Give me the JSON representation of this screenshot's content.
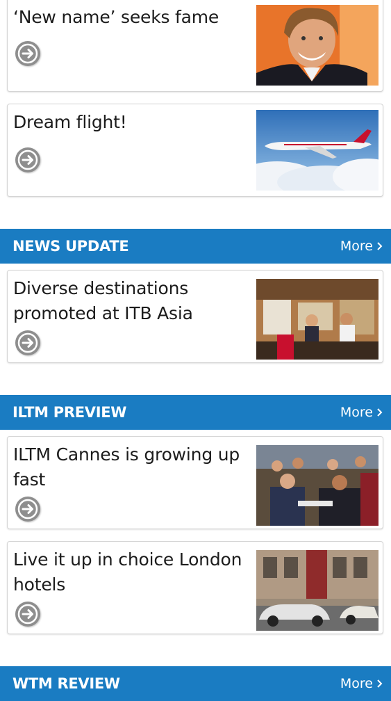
{
  "articles_top": [
    {
      "title": "‘New name’ seeks fame",
      "image": "portrait-photo"
    },
    {
      "title": "Dream flight!",
      "image": "airplane-photo"
    }
  ],
  "sections": [
    {
      "title": "NEWS UPDATE",
      "more_label": "More",
      "articles": [
        {
          "title": "Diverse destinations promoted at ITB Asia",
          "image": "trade-show-photo"
        }
      ]
    },
    {
      "title": "ILTM PREVIEW",
      "more_label": "More",
      "articles": [
        {
          "title": "ILTM Cannes is growing up fast",
          "image": "meeting-hall-photo"
        },
        {
          "title": "Live it up in choice London hotels",
          "image": "hotel-vintage-car-photo"
        }
      ]
    },
    {
      "title": "WTM REVIEW",
      "more_label": "More"
    }
  ],
  "icons": {
    "read_more": "arrow-right-circle-icon",
    "more": "chevron-right-icon"
  },
  "colors": {
    "section_bar": "#1a7cc2",
    "arrow_button": "#8e8e8e"
  }
}
